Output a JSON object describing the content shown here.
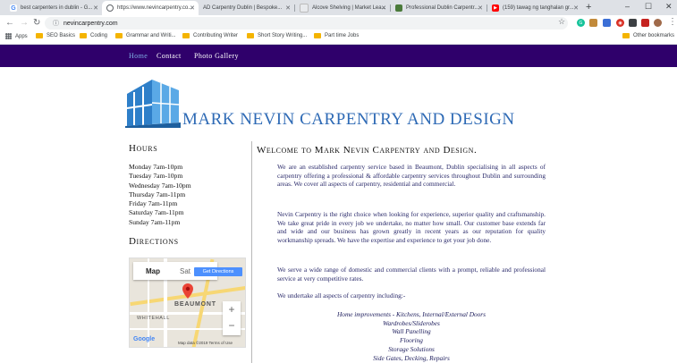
{
  "browser": {
    "tabs": [
      {
        "title": "best carpenters in dublin - G...",
        "favicon": "google-icon",
        "active": false
      },
      {
        "title": "https://www.nevincarpentry.co...",
        "favicon": "globe-icon",
        "active": true
      },
      {
        "title": "AD  Carpentry Dublin | Bespoke...",
        "favicon": "ad-icon",
        "active": false
      },
      {
        "title": "Alcove Shelving | Market Lea...",
        "favicon": "page-icon",
        "active": false
      },
      {
        "title": "Professional Dublin Carpentr...",
        "favicon": "site-icon",
        "active": false
      },
      {
        "title": "(159) tawag ng tanghalan gr...",
        "favicon": "youtube-icon",
        "active": false
      }
    ],
    "address": "nevincarpentry.com",
    "bookmarks": [
      {
        "label": "Apps",
        "type": "apps"
      },
      {
        "label": "SEO Basics",
        "type": "folder"
      },
      {
        "label": "Coding",
        "type": "folder"
      },
      {
        "label": "Grammar and Writi...",
        "type": "folder"
      },
      {
        "label": "Contributing Writer",
        "type": "folder"
      },
      {
        "label": "Short Story Writing...",
        "type": "folder"
      },
      {
        "label": "Part time Jobs",
        "type": "folder"
      },
      {
        "label": "Other bookmarks",
        "type": "folder"
      }
    ]
  },
  "site": {
    "nav": [
      {
        "label": "Home",
        "current": true
      },
      {
        "label": "Contact",
        "current": false
      },
      {
        "label": "Photo Gallery",
        "current": false
      }
    ],
    "title": "MARK NEVIN CARPENTRY AND DESIGN",
    "colors": {
      "nav_bg": "#2f006b",
      "title": "#2e6ab5",
      "current_link": "#7fb0e6"
    }
  },
  "sidebar": {
    "hours_heading": "Hours",
    "hours": [
      "Monday 7am-10pm",
      "Tuesday 7am-10pm",
      "Wednesday 7am-10pm",
      "Thursday 7am-11pm",
      "Friday 7am-11pm",
      "Saturday 7am-11pm",
      "Sunday 7am-11pm"
    ],
    "directions_heading": "Directions",
    "map": {
      "tab_map": "Map",
      "tab_satellite": "Sat",
      "get_directions": "Get Directions",
      "label_area": "BEAUMONT",
      "label_area2": "WHITEHALL",
      "zoom_in": "+",
      "zoom_out": "−",
      "brand": "Google",
      "attribution": "Map data ©2019   Terms of Use"
    }
  },
  "main": {
    "heading": "Welcome to Mark Nevin Carpentry and Design.",
    "paragraphs": [
      "We are an established carpentry service based in Beaumont, Dublin  specialising in all aspects of carpentry offering a professional & affordable carpentry services throughout Dublin and surrounding areas.  We cover all aspects of carpentry, residential and commercial.",
      "Nevin Carpentry is the right choice when looking for experience, superior quality and craftsmanship.  We take great pride in every job we  undertake, no matter how small. Our customer base extends far and wide and our business has grown greatly in recent years as our reputation for quality workmanship spreads.  We have the expertise and experience to get your job done.",
      "We serve a wide range of domestic and commercial clients with a prompt, reliable and professional service at very competitive rates.",
      "We undertake all aspects of carpentry including:-"
    ],
    "services": [
      "Home improvements - Kitchens,  Internal/External Doors",
      "Wardrobes/Sliderobes",
      "Wall Panelling",
      "Flooring",
      "Storage Solutions",
      "Side Gates, Decking, Repairs"
    ]
  }
}
